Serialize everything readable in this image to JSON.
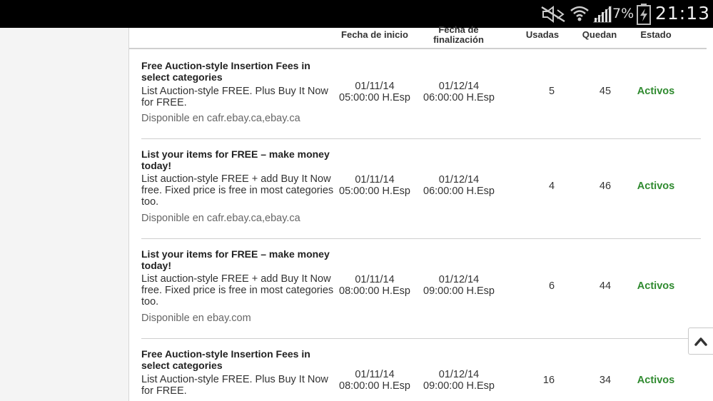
{
  "status_bar": {
    "battery_percent": "7%",
    "time": "21:13",
    "icons": [
      "mute-icon",
      "wifi-icon",
      "signal-icon",
      "battery-icon"
    ]
  },
  "table": {
    "headers": {
      "start": "Fecha de inicio",
      "end": "Fecha de finalización",
      "used": "Usadas",
      "remaining": "Quedan",
      "state": "Estado"
    },
    "rows": [
      {
        "title": "Free Auction-style Insertion Fees in select categories",
        "description": "List Auction-style FREE. Plus Buy It Now for FREE.",
        "available": "Disponible en cafr.ebay.ca,ebay.ca",
        "start_date": "01/11/14",
        "start_time": "05:00:00 H.Esp",
        "end_date": "01/12/14",
        "end_time": "06:00:00 H.Esp",
        "used": "5",
        "remaining": "45",
        "state": "Activos"
      },
      {
        "title": "List your items for FREE – make money today!",
        "description": "List auction-style FREE + add Buy It Now free. Fixed price is free in most categories too.",
        "available": "Disponible en cafr.ebay.ca,ebay.ca",
        "start_date": "01/11/14",
        "start_time": "05:00:00 H.Esp",
        "end_date": "01/12/14",
        "end_time": "06:00:00 H.Esp",
        "used": "4",
        "remaining": "46",
        "state": "Activos"
      },
      {
        "title": "List your items for FREE – make money today!",
        "description": "List auction-style FREE + add Buy It Now free. Fixed price is free in most categories too.",
        "available": "Disponible en ebay.com",
        "start_date": "01/11/14",
        "start_time": "08:00:00 H.Esp",
        "end_date": "01/12/14",
        "end_time": "09:00:00 H.Esp",
        "used": "6",
        "remaining": "44",
        "state": "Activos"
      },
      {
        "title": "Free Auction-style Insertion Fees in select categories",
        "description": "List Auction-style FREE. Plus Buy It Now for FREE.",
        "start_date": "01/11/14",
        "start_time": "08:00:00 H.Esp",
        "end_date": "01/12/14",
        "end_time": "09:00:00 H.Esp",
        "used": "16",
        "remaining": "34",
        "state": "Activos"
      }
    ]
  },
  "colors": {
    "status_active": "#2f8a2f",
    "status_bar_bg": "#000000",
    "side_panel_bg": "#f4f4f4"
  }
}
